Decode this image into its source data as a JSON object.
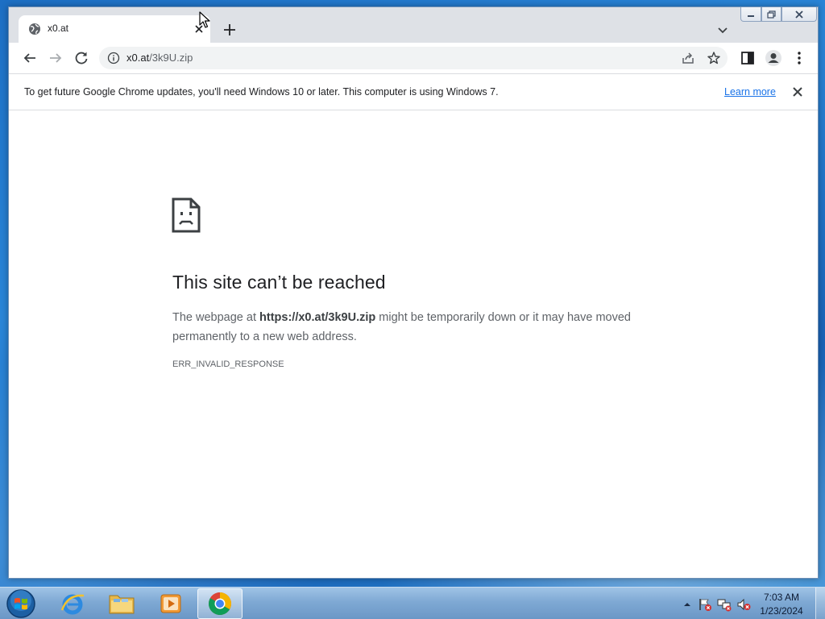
{
  "browser": {
    "tab": {
      "title": "x0.at"
    },
    "address": {
      "host": "x0.at",
      "path": "/3k9U.zip"
    },
    "infobar": {
      "message": "To get future Google Chrome updates, you'll need Windows 10 or later. This computer is using Windows 7.",
      "link_label": "Learn more"
    },
    "error": {
      "title": "This site can’t be reached",
      "desc_prefix": "The webpage at ",
      "desc_url": "https://x0.at/3k9U.zip",
      "desc_suffix": " might be temporarily down or it may have moved permanently to a new web address.",
      "code": "ERR_INVALID_RESPONSE"
    }
  },
  "taskbar": {
    "apps": [
      "internet-explorer",
      "file-explorer",
      "media-player",
      "google-chrome"
    ],
    "active_app": "google-chrome",
    "clock": {
      "time": "7:03 AM",
      "date": "1/23/2024"
    }
  },
  "colors": {
    "link": "#1a73e8",
    "tabstrip": "#dee1e6",
    "omnibox": "#f1f3f4",
    "error_text": "#5f6368"
  }
}
